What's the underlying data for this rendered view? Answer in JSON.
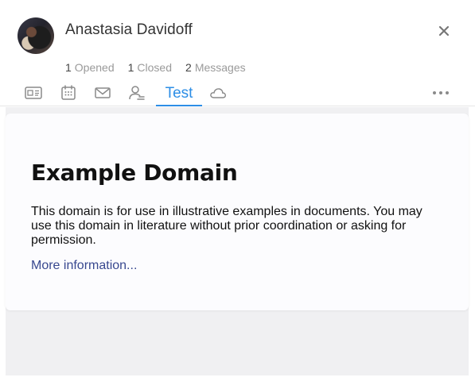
{
  "contact": {
    "name": "Anastasia Davidoff"
  },
  "stats": [
    {
      "count": "1",
      "label": "Opened"
    },
    {
      "count": "1",
      "label": "Closed"
    },
    {
      "count": "2",
      "label": "Messages"
    }
  ],
  "tabs": [
    {
      "icon": "contact-card-icon"
    },
    {
      "icon": "calendar-icon"
    },
    {
      "icon": "mail-icon"
    },
    {
      "icon": "users-icon"
    },
    {
      "label": "Test",
      "active": true
    },
    {
      "icon": "cloud-icon"
    },
    {
      "icon": "more-icon"
    }
  ],
  "webview": {
    "title": "Example Domain",
    "description": "This domain is for use in illustrative examples in documents. You may use this domain in literature without prior coordination or asking for permission.",
    "link": "More information..."
  },
  "colors": {
    "accent": "#2d8ee6",
    "link": "#38488f",
    "background": "#f0f0f2"
  }
}
